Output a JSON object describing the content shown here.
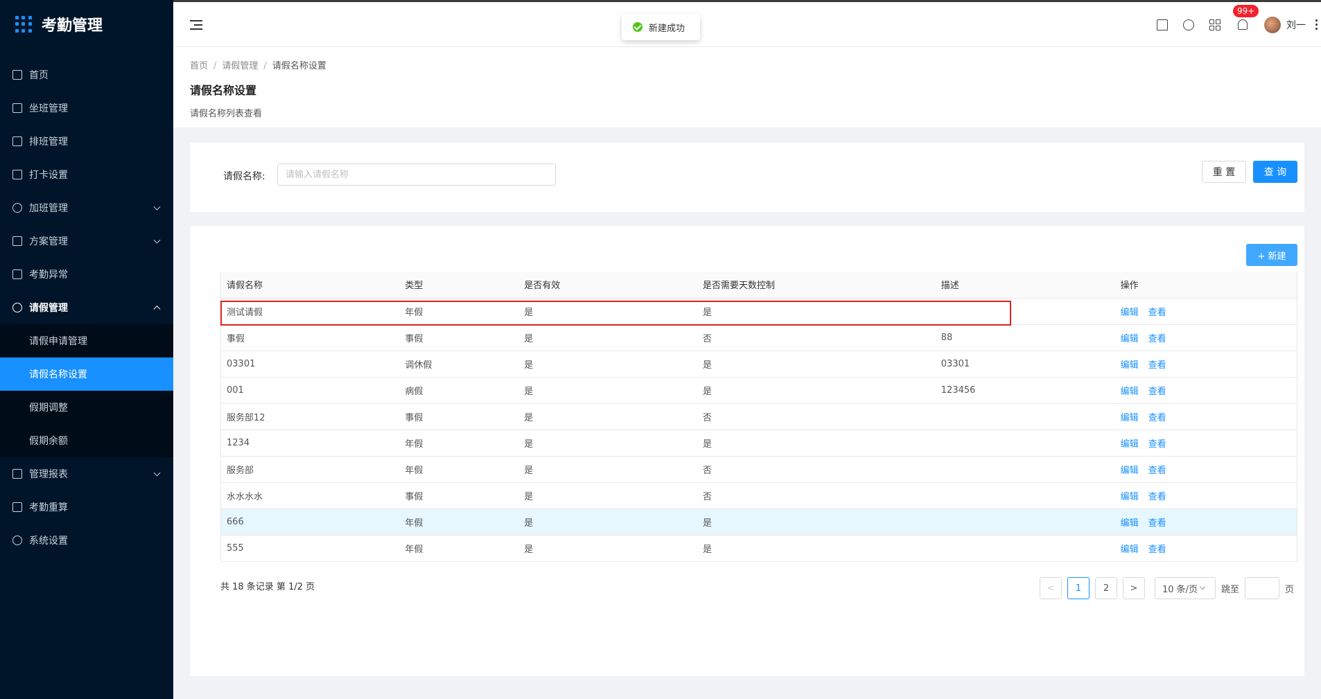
{
  "brand": {
    "title": "考勤管理"
  },
  "sidebar": {
    "items": [
      {
        "label": "首页"
      },
      {
        "label": "坐班管理"
      },
      {
        "label": "排班管理"
      },
      {
        "label": "打卡设置"
      },
      {
        "label": "加班管理"
      },
      {
        "label": "方案管理"
      },
      {
        "label": "考勤异常"
      },
      {
        "label": "请假管理"
      },
      {
        "label": "管理报表"
      },
      {
        "label": "考勤重算"
      },
      {
        "label": "系统设置"
      }
    ],
    "submenu": [
      {
        "label": "请假申请管理"
      },
      {
        "label": "请假名称设置"
      },
      {
        "label": "假期调整"
      },
      {
        "label": "假期余额"
      }
    ]
  },
  "header": {
    "notif_count": "99+",
    "user_name": "刘一"
  },
  "toast": {
    "text": "新建成功"
  },
  "breadcrumb": {
    "home": "首页",
    "parent": "请假管理",
    "current": "请假名称设置"
  },
  "page": {
    "title": "请假名称设置",
    "subtitle": "请假名称列表查看"
  },
  "search": {
    "label": "请假名称:",
    "placeholder": "请输入请假名称",
    "reset": "重 置",
    "query": "查 询"
  },
  "toolbar": {
    "new_label": "+ 新建"
  },
  "table": {
    "headers": [
      "请假名称",
      "类型",
      "是否有效",
      "是否需要天数控制",
      "描述",
      "操作"
    ],
    "rows": [
      {
        "name": "测试请假",
        "type": "年假",
        "valid": "是",
        "days_control": "是",
        "desc": "",
        "edit": "编辑",
        "view": "查看"
      },
      {
        "name": "事假",
        "type": "事假",
        "valid": "是",
        "days_control": "否",
        "desc": "88",
        "edit": "编辑",
        "view": "查看"
      },
      {
        "name": "03301",
        "type": "调休假",
        "valid": "是",
        "days_control": "是",
        "desc": "03301",
        "edit": "编辑",
        "view": "查看"
      },
      {
        "name": "001",
        "type": "病假",
        "valid": "是",
        "days_control": "是",
        "desc": "123456",
        "edit": "编辑",
        "view": "查看"
      },
      {
        "name": "服务部12",
        "type": "事假",
        "valid": "是",
        "days_control": "否",
        "desc": "",
        "edit": "编辑",
        "view": "查看"
      },
      {
        "name": "1234",
        "type": "年假",
        "valid": "是",
        "days_control": "是",
        "desc": "",
        "edit": "编辑",
        "view": "查看"
      },
      {
        "name": "服务部",
        "type": "年假",
        "valid": "是",
        "days_control": "否",
        "desc": "",
        "edit": "编辑",
        "view": "查看"
      },
      {
        "name": "水水水水",
        "type": "事假",
        "valid": "是",
        "days_control": "否",
        "desc": "",
        "edit": "编辑",
        "view": "查看"
      },
      {
        "name": "666",
        "type": "年假",
        "valid": "是",
        "days_control": "是",
        "desc": "",
        "edit": "编辑",
        "view": "查看"
      },
      {
        "name": "555",
        "type": "年假",
        "valid": "是",
        "days_control": "是",
        "desc": "",
        "edit": "编辑",
        "view": "查看"
      }
    ]
  },
  "pagination": {
    "total_text": "共 18 条记录 第 1/2 页",
    "prev": "<",
    "pages": [
      "1",
      "2"
    ],
    "next": ">",
    "page_size": "10 条/页",
    "jump_label": "跳至",
    "page_unit": "页"
  }
}
